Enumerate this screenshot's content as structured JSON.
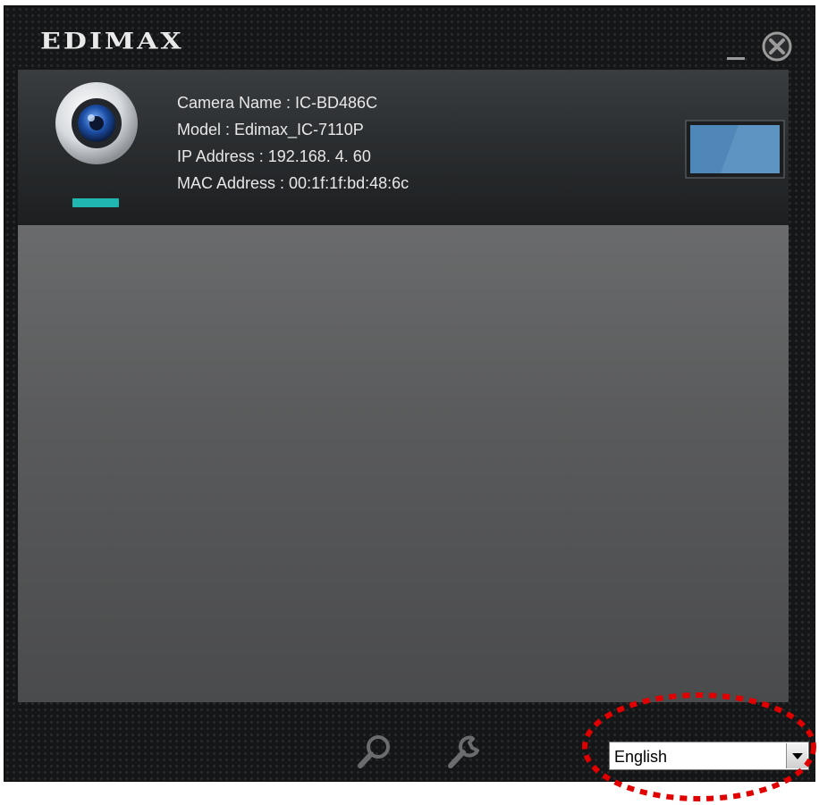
{
  "app": {
    "brand": "EDIMAX",
    "window_controls": {
      "minimize": "minimize",
      "close": "close"
    }
  },
  "camera": {
    "name_line": "Camera Name : IC-BD486C",
    "model_line": "Model : Edimax_IC-7110P",
    "ip_line": "IP Address : 192.168.  4. 60",
    "mac_line": "MAC Address : 00:1f:1f:bd:48:6c",
    "status_color": "#1fb7b0"
  },
  "toolbar": {
    "search_icon": "magnifier-icon",
    "settings_icon": "wrench-icon"
  },
  "language": {
    "selected": "English"
  },
  "annotation": {
    "highlight_color": "#e00000"
  }
}
